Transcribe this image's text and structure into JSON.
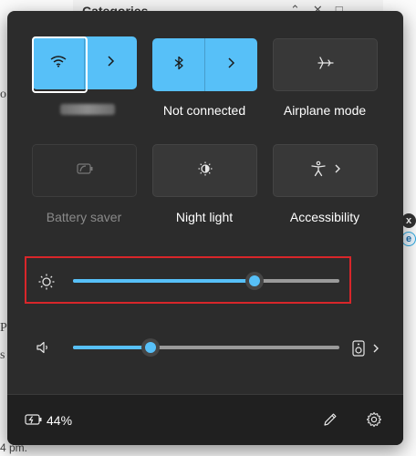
{
  "background": {
    "window_title": "Categories",
    "right_badge_1": "x",
    "right_badge_2": "e",
    "bottom_text": "4 pm."
  },
  "tiles": {
    "wifi": {
      "label": "",
      "state": "on"
    },
    "bluetooth": {
      "label": "Not connected",
      "state": "on"
    },
    "airplane": {
      "label": "Airplane mode",
      "state": "off"
    },
    "battery_saver": {
      "label": "Battery saver",
      "state": "disabled"
    },
    "night_light": {
      "label": "Night light",
      "state": "off"
    },
    "accessibility": {
      "label": "Accessibility",
      "state": "off"
    }
  },
  "sliders": {
    "brightness": {
      "fraction": 0.68,
      "highlighted": true
    },
    "volume": {
      "fraction": 0.29
    }
  },
  "footer": {
    "battery_percent": "44%"
  },
  "colors": {
    "accent": "#57c0f8",
    "panel": "#2c2c2c",
    "footer": "#202020",
    "highlight_box": "#d8262a"
  }
}
